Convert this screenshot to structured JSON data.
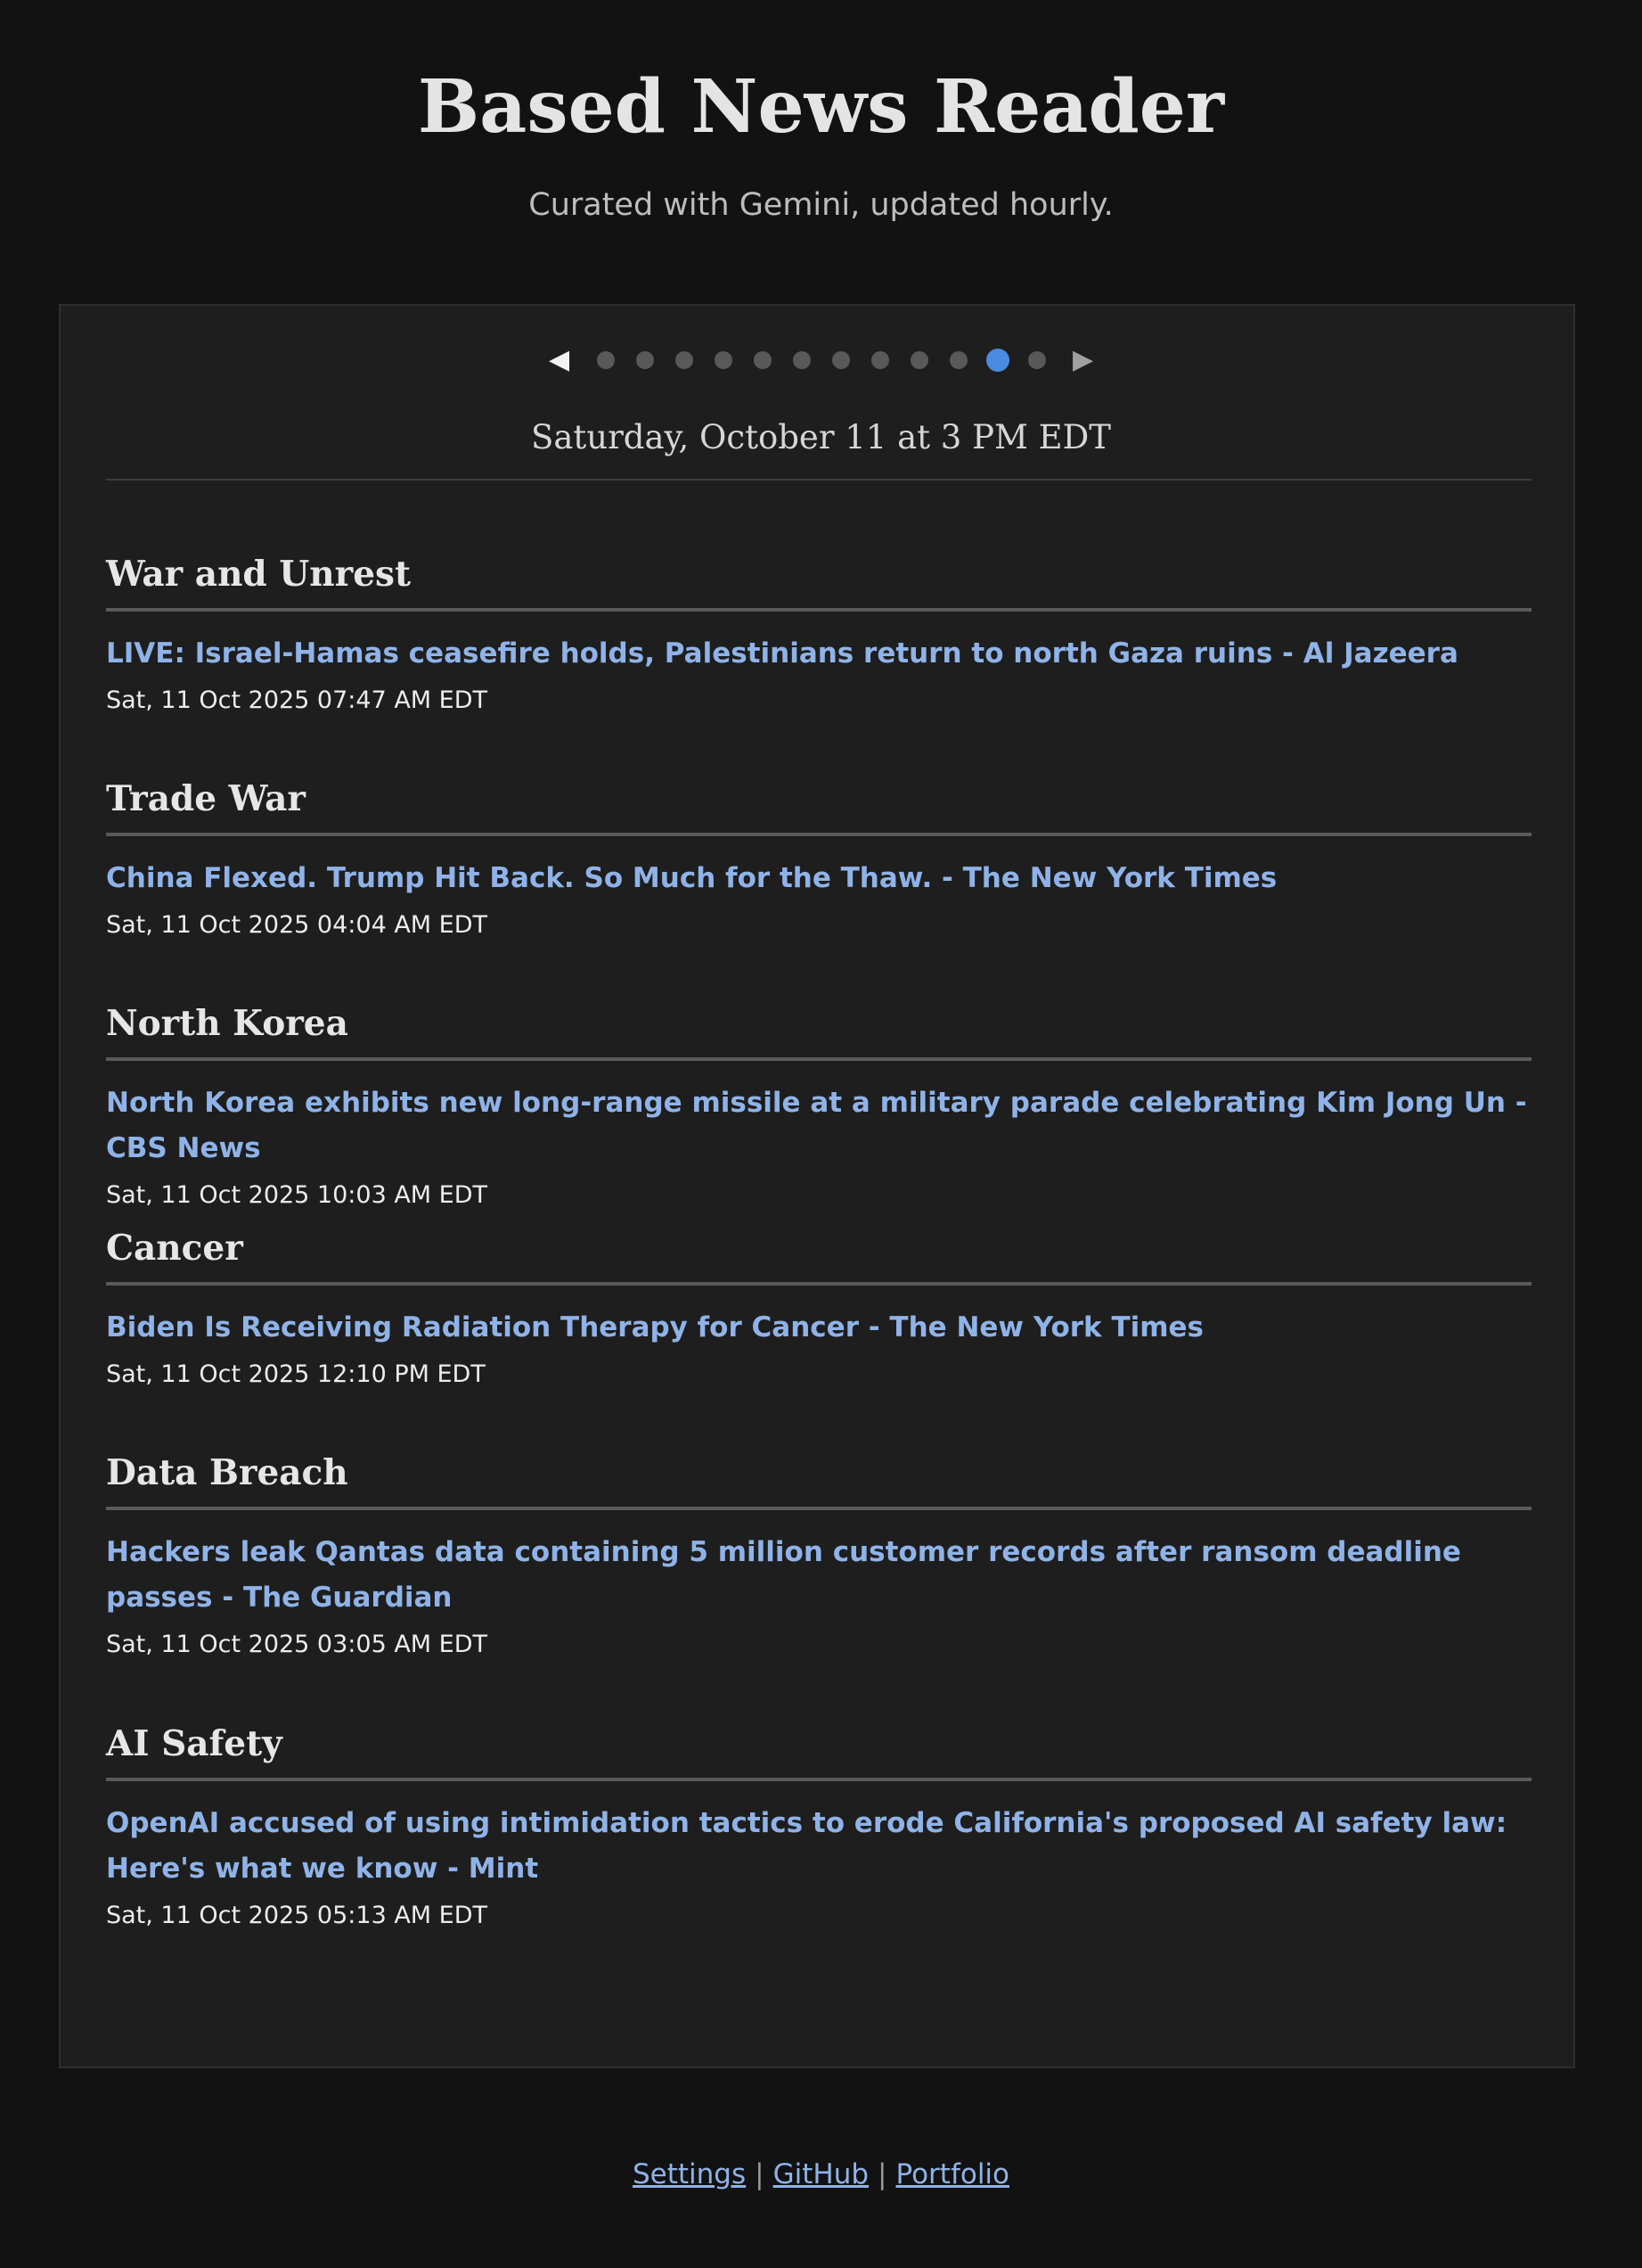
{
  "header": {
    "title": "Based News Reader",
    "subtitle": "Curated with Gemini, updated hourly."
  },
  "pager": {
    "prev_icon": "◀",
    "next_icon": "▶",
    "dot_count": 12,
    "active_index": 10,
    "colors": {
      "dot": "#595959",
      "active": "#4a8ae0"
    }
  },
  "edition": {
    "date": "Saturday, October 11 at 3 PM EDT"
  },
  "sections": [
    {
      "title": "War and Unrest",
      "article": "LIVE: Israel-Hamas ceasefire holds, Palestinians return to north Gaza ruins - Al Jazeera",
      "time": "Sat, 11 Oct 2025 07:47 AM EDT"
    },
    {
      "title": "Trade War",
      "article": "China Flexed. Trump Hit Back. So Much for the Thaw. - The New York Times",
      "time": "Sat, 11 Oct 2025 04:04 AM EDT"
    },
    {
      "title": "North Korea",
      "article": "North Korea exhibits new long-range missile at a military parade celebrating Kim Jong Un - CBS News",
      "time": "Sat, 11 Oct 2025 10:03 AM EDT"
    },
    {
      "title": "Cancer",
      "article": "Biden Is Receiving Radiation Therapy for Cancer - The New York Times",
      "time": "Sat, 11 Oct 2025 12:10 PM EDT"
    },
    {
      "title": "Data Breach",
      "article": "Hackers leak Qantas data containing 5 million customer records after ransom deadline passes - The Guardian",
      "time": "Sat, 11 Oct 2025 03:05 AM EDT"
    },
    {
      "title": "AI Safety",
      "article": "OpenAI accused of using intimidation tactics to erode California's proposed AI safety law: Here's what we know - Mint",
      "time": "Sat, 11 Oct 2025 05:13 AM EDT"
    }
  ],
  "footer": {
    "links": [
      "Settings",
      "GitHub",
      "Portfolio"
    ],
    "separator": "|"
  },
  "colors": {
    "background": "#121212",
    "card": "#1e1e1e",
    "link": "#8fb3e8"
  }
}
